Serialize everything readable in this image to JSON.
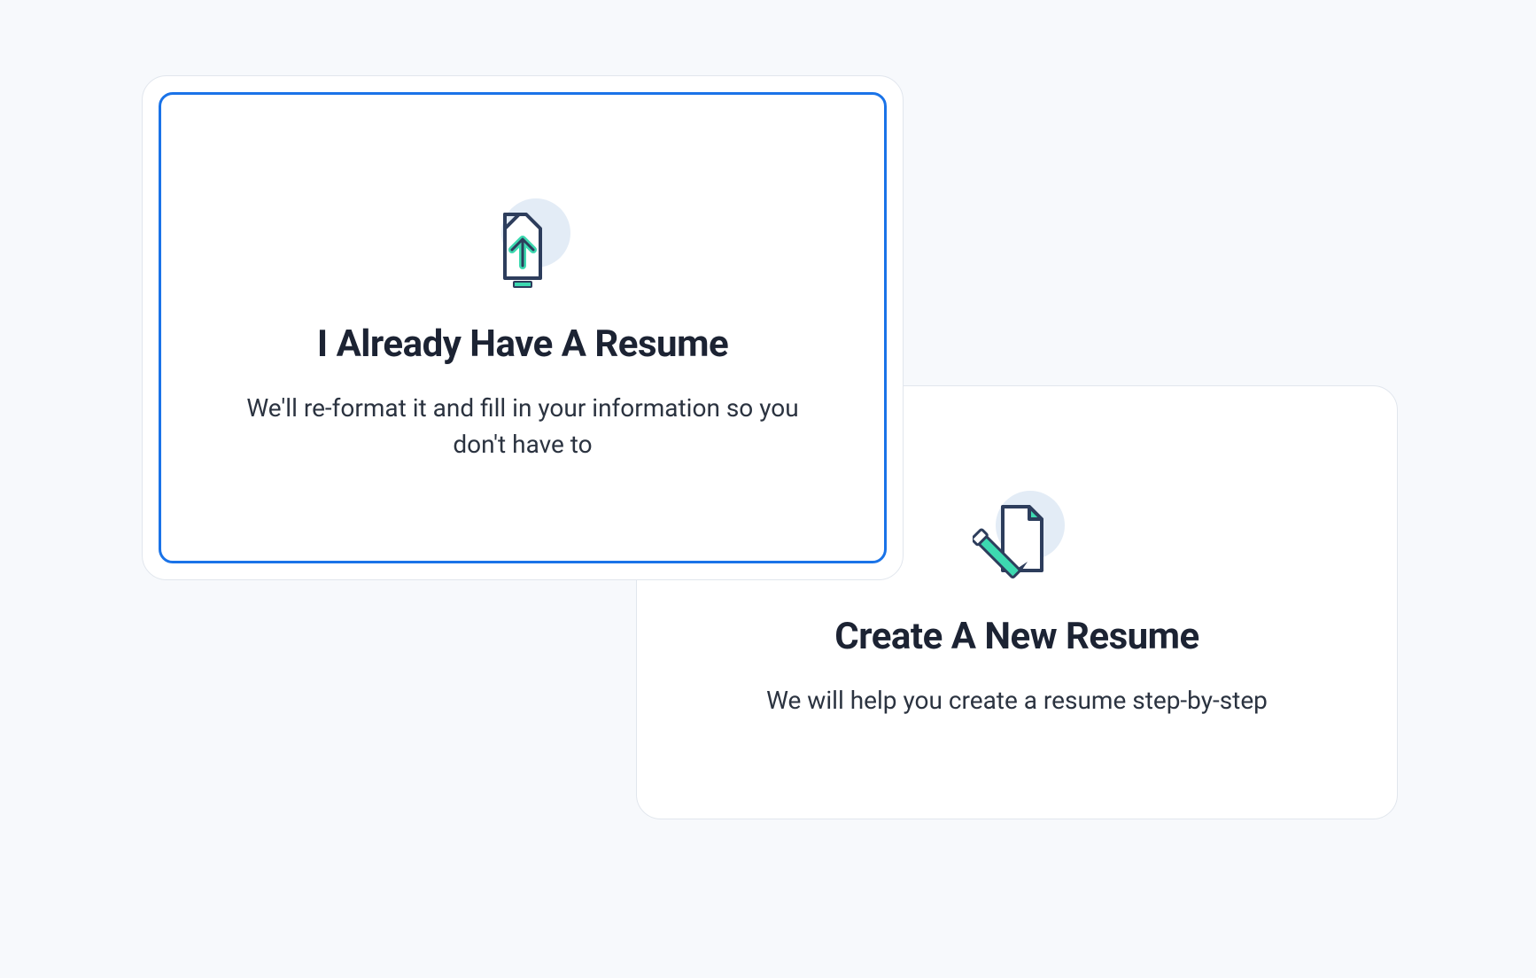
{
  "options": {
    "upload": {
      "title": "I Already Have A Resume",
      "description": "We'll re-format it and fill in your information so you don't have to"
    },
    "create": {
      "title": "Create A New Resume",
      "description": "We will help you create a resume step-by-step"
    }
  },
  "colors": {
    "accent": "#1a73e8",
    "icon_stroke": "#2d3d5c",
    "icon_fill": "#3dd9b0"
  }
}
